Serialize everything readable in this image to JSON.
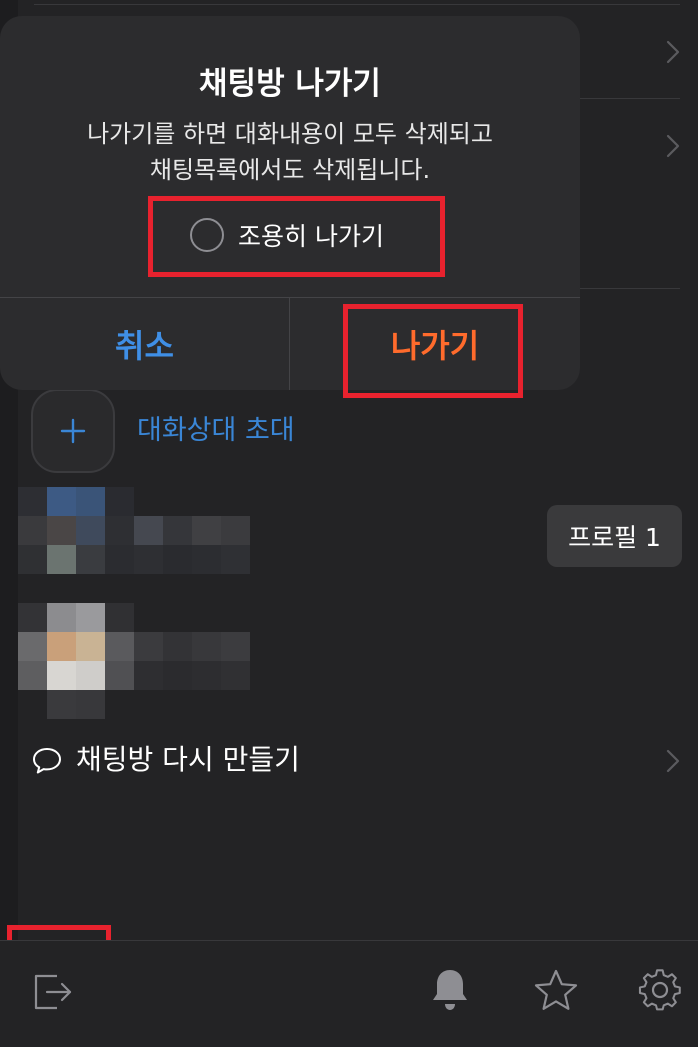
{
  "dialog": {
    "title": "채팅방 나가기",
    "message_line1": "나가기를 하면 대화내용이 모두 삭제되고",
    "message_line2": "채팅목록에서도 삭제됩니다.",
    "quiet_leave_label": "조용히 나가기",
    "quiet_leave_checked": false,
    "cancel_label": "취소",
    "leave_label": "나가기"
  },
  "members": {
    "invite_label": "대화상대 초대",
    "profile_badge_label": "프로필 1"
  },
  "actions": {
    "recreate_chat_label": "채팅방 다시 만들기"
  },
  "icons": {
    "exit": "exit-icon",
    "bell": "bell-icon",
    "star": "star-icon",
    "settings": "gear-icon",
    "plus": "plus-icon",
    "chat_bubble": "chat-bubble-icon",
    "chevron": "chevron-right-icon"
  },
  "colors": {
    "background": "#232325",
    "dialog_background": "#2c2c2e",
    "cancel_text": "#3f8fe6",
    "leave_text": "#ff6b2c",
    "invite_text": "#3a86d6",
    "highlight_border": "#e8222e"
  }
}
